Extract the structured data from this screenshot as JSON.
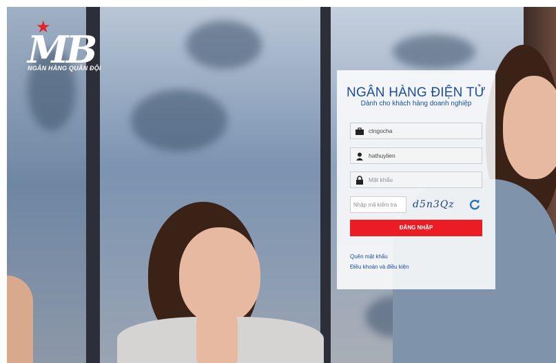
{
  "brand": {
    "logo_mark": "MB",
    "logo_text": "NGÂN HÀNG QUÂN ĐỘI",
    "star_color": "#e1232b"
  },
  "login": {
    "title": "NGÂN HÀNG ĐIỆN TỬ",
    "subtitle": "Dành cho khách hàng doanh nghiệp",
    "company_id_value": "ctngocha",
    "username_value": "hathuylien",
    "password_placeholder": "Mật khẩu",
    "captcha_placeholder": "Nhập mã kiểm tra",
    "captcha_code": "d5n3Qz",
    "submit_label": "ĐĂNG NHẬP",
    "forgot_password_link": "Quên mật khẩu",
    "terms_link": "Điều khoản và điều kiện"
  },
  "colors": {
    "title_blue": "#1b4d9b",
    "button_red": "#ec1c24"
  },
  "icons": {
    "company": "briefcase-icon",
    "user": "user-icon",
    "password": "lock-icon",
    "refresh": "refresh-icon"
  }
}
